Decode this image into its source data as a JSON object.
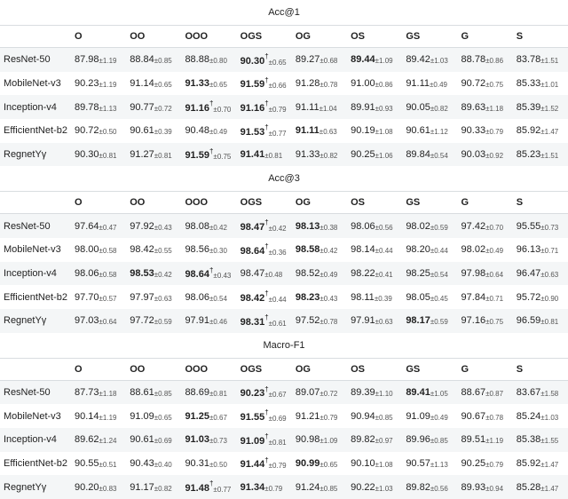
{
  "columns": [
    "O",
    "OO",
    "OOO",
    "OGS",
    "OG",
    "OS",
    "GS",
    "G",
    "S"
  ],
  "models": [
    "ResNet-50",
    "MobileNet-v3",
    "Inception-v4",
    "EfficientNet-b2",
    "RegnetYγ"
  ],
  "model_display": [
    "ResNet-50",
    "MobileNet-v3",
    "Inception-v4",
    "EfficientNet-b2",
    "RegnetYγ"
  ],
  "sections": [
    {
      "title": "Acc@1",
      "rows": [
        [
          {
            "v": "87.98",
            "s": "±1.19"
          },
          {
            "v": "88.84",
            "s": "±0.85"
          },
          {
            "v": "88.88",
            "s": "±0.80"
          },
          {
            "v": "90.30",
            "s": "±0.65",
            "b": true,
            "d": true
          },
          {
            "v": "89.27",
            "s": "±0.68"
          },
          {
            "v": "89.44",
            "s": "±1.09",
            "b": true
          },
          {
            "v": "89.42",
            "s": "±1.03"
          },
          {
            "v": "88.78",
            "s": "±0.86"
          },
          {
            "v": "83.78",
            "s": "±1.51"
          }
        ],
        [
          {
            "v": "90.23",
            "s": "±1.19"
          },
          {
            "v": "91.14",
            "s": "±0.65"
          },
          {
            "v": "91.33",
            "s": "±0.65",
            "b": true
          },
          {
            "v": "91.59",
            "s": "±0.66",
            "b": true,
            "d": true
          },
          {
            "v": "91.28",
            "s": "±0.78"
          },
          {
            "v": "91.00",
            "s": "±0.86"
          },
          {
            "v": "91.11",
            "s": "±0.49"
          },
          {
            "v": "90.72",
            "s": "±0.75"
          },
          {
            "v": "85.33",
            "s": "±1.01"
          }
        ],
        [
          {
            "v": "89.78",
            "s": "±1.13"
          },
          {
            "v": "90.77",
            "s": "±0.72"
          },
          {
            "v": "91.16",
            "s": "±0.70",
            "b": true,
            "d": true
          },
          {
            "v": "91.16",
            "s": "±0.79",
            "b": true,
            "d": true
          },
          {
            "v": "91.11",
            "s": "±1.04"
          },
          {
            "v": "89.91",
            "s": "±0.93"
          },
          {
            "v": "90.05",
            "s": "±0.82"
          },
          {
            "v": "89.63",
            "s": "±1.18"
          },
          {
            "v": "85.39",
            "s": "±1.52"
          }
        ],
        [
          {
            "v": "90.72",
            "s": "±0.50"
          },
          {
            "v": "90.61",
            "s": "±0.39"
          },
          {
            "v": "90.48",
            "s": "±0.49"
          },
          {
            "v": "91.53",
            "s": "±0.77",
            "b": true,
            "d": true
          },
          {
            "v": "91.11",
            "s": "±0.63",
            "b": true
          },
          {
            "v": "90.19",
            "s": "±1.08"
          },
          {
            "v": "90.61",
            "s": "±1.12"
          },
          {
            "v": "90.33",
            "s": "±0.79"
          },
          {
            "v": "85.92",
            "s": "±1.47"
          }
        ],
        [
          {
            "v": "90.30",
            "s": "±0.81"
          },
          {
            "v": "91.27",
            "s": "±0.81"
          },
          {
            "v": "91.59",
            "s": "±0.75",
            "b": true,
            "d": true
          },
          {
            "v": "91.41",
            "s": "±0.81",
            "b": true
          },
          {
            "v": "91.33",
            "s": "±0.82"
          },
          {
            "v": "90.25",
            "s": "±1.06"
          },
          {
            "v": "89.84",
            "s": "±0.54"
          },
          {
            "v": "90.03",
            "s": "±0.92"
          },
          {
            "v": "85.23",
            "s": "±1.51"
          }
        ]
      ]
    },
    {
      "title": "Acc@3",
      "rows": [
        [
          {
            "v": "97.64",
            "s": "±0.47"
          },
          {
            "v": "97.92",
            "s": "±0.43"
          },
          {
            "v": "98.08",
            "s": "±0.42"
          },
          {
            "v": "98.47",
            "s": "±0.42",
            "b": true,
            "d": true
          },
          {
            "v": "98.13",
            "s": "±0.38",
            "b": true
          },
          {
            "v": "98.06",
            "s": "±0.56"
          },
          {
            "v": "98.02",
            "s": "±0.59"
          },
          {
            "v": "97.42",
            "s": "±0.70"
          },
          {
            "v": "95.55",
            "s": "±0.73"
          }
        ],
        [
          {
            "v": "98.00",
            "s": "±0.58"
          },
          {
            "v": "98.42",
            "s": "±0.55"
          },
          {
            "v": "98.56",
            "s": "±0.30"
          },
          {
            "v": "98.64",
            "s": "±0.36",
            "b": true,
            "d": true
          },
          {
            "v": "98.58",
            "s": "±0.42",
            "b": true
          },
          {
            "v": "98.14",
            "s": "±0.44"
          },
          {
            "v": "98.20",
            "s": "±0.44"
          },
          {
            "v": "98.02",
            "s": "±0.49"
          },
          {
            "v": "96.13",
            "s": "±0.71"
          }
        ],
        [
          {
            "v": "98.06",
            "s": "±0.58"
          },
          {
            "v": "98.53",
            "s": "±0.42",
            "b": true
          },
          {
            "v": "98.64",
            "s": "±0.43",
            "b": true,
            "d": true
          },
          {
            "v": "98.47",
            "s": "±0.48"
          },
          {
            "v": "98.52",
            "s": "±0.49"
          },
          {
            "v": "98.22",
            "s": "±0.41"
          },
          {
            "v": "98.25",
            "s": "±0.54"
          },
          {
            "v": "97.98",
            "s": "±0.64"
          },
          {
            "v": "96.47",
            "s": "±0.63"
          }
        ],
        [
          {
            "v": "97.70",
            "s": "±0.57"
          },
          {
            "v": "97.97",
            "s": "±0.63"
          },
          {
            "v": "98.06",
            "s": "±0.54"
          },
          {
            "v": "98.42",
            "s": "±0.44",
            "b": true,
            "d": true
          },
          {
            "v": "98.23",
            "s": "±0.43",
            "b": true
          },
          {
            "v": "98.11",
            "s": "±0.39"
          },
          {
            "v": "98.05",
            "s": "±0.45"
          },
          {
            "v": "97.84",
            "s": "±0.71"
          },
          {
            "v": "95.72",
            "s": "±0.90"
          }
        ],
        [
          {
            "v": "97.03",
            "s": "±0.64"
          },
          {
            "v": "97.72",
            "s": "±0.59"
          },
          {
            "v": "97.91",
            "s": "±0.46"
          },
          {
            "v": "98.31",
            "s": "±0.61",
            "b": true,
            "d": true
          },
          {
            "v": "97.52",
            "s": "±0.78"
          },
          {
            "v": "97.91",
            "s": "±0.63"
          },
          {
            "v": "98.17",
            "s": "±0.59",
            "b": true
          },
          {
            "v": "97.16",
            "s": "±0.75"
          },
          {
            "v": "96.59",
            "s": "±0.81"
          }
        ]
      ]
    },
    {
      "title": "Macro-F1",
      "rows": [
        [
          {
            "v": "87.73",
            "s": "±1.18"
          },
          {
            "v": "88.61",
            "s": "±0.85"
          },
          {
            "v": "88.69",
            "s": "±0.81"
          },
          {
            "v": "90.23",
            "s": "±0.67",
            "b": true,
            "d": true
          },
          {
            "v": "89.07",
            "s": "±0.72"
          },
          {
            "v": "89.39",
            "s": "±1.10"
          },
          {
            "v": "89.41",
            "s": "±1.05",
            "b": true
          },
          {
            "v": "88.67",
            "s": "±0.87"
          },
          {
            "v": "83.67",
            "s": "±1.58"
          }
        ],
        [
          {
            "v": "90.14",
            "s": "±1.19"
          },
          {
            "v": "91.09",
            "s": "±0.65"
          },
          {
            "v": "91.25",
            "s": "±0.67",
            "b": true
          },
          {
            "v": "91.55",
            "s": "±0.69",
            "b": true,
            "d": true
          },
          {
            "v": "91.21",
            "s": "±0.79"
          },
          {
            "v": "90.94",
            "s": "±0.85"
          },
          {
            "v": "91.09",
            "s": "±0.49"
          },
          {
            "v": "90.67",
            "s": "±0.78"
          },
          {
            "v": "85.24",
            "s": "±1.03"
          }
        ],
        [
          {
            "v": "89.62",
            "s": "±1.24"
          },
          {
            "v": "90.61",
            "s": "±0.69"
          },
          {
            "v": "91.03",
            "s": "±0.73",
            "b": true
          },
          {
            "v": "91.09",
            "s": "±0.81",
            "b": true,
            "d": true
          },
          {
            "v": "90.98",
            "s": "±1.09"
          },
          {
            "v": "89.82",
            "s": "±0.97"
          },
          {
            "v": "89.96",
            "s": "±0.85"
          },
          {
            "v": "89.51",
            "s": "±1.19"
          },
          {
            "v": "85.38",
            "s": "±1.55"
          }
        ],
        [
          {
            "v": "90.55",
            "s": "±0.51"
          },
          {
            "v": "90.43",
            "s": "±0.40"
          },
          {
            "v": "90.31",
            "s": "±0.50"
          },
          {
            "v": "91.44",
            "s": "±0.79",
            "b": true,
            "d": true
          },
          {
            "v": "90.99",
            "s": "±0.65",
            "b": true
          },
          {
            "v": "90.10",
            "s": "±1.08"
          },
          {
            "v": "90.57",
            "s": "±1.13"
          },
          {
            "v": "90.25",
            "s": "±0.79"
          },
          {
            "v": "85.92",
            "s": "±1.47"
          }
        ],
        [
          {
            "v": "90.20",
            "s": "±0.83"
          },
          {
            "v": "91.17",
            "s": "±0.82"
          },
          {
            "v": "91.48",
            "s": "±0.77",
            "b": true,
            "d": true
          },
          {
            "v": "91.34",
            "s": "±0.79",
            "b": true
          },
          {
            "v": "91.24",
            "s": "±0.85"
          },
          {
            "v": "90.22",
            "s": "±1.03"
          },
          {
            "v": "89.82",
            "s": "±0.56"
          },
          {
            "v": "89.93",
            "s": "±0.94"
          },
          {
            "v": "85.28",
            "s": "±1.47"
          }
        ]
      ]
    }
  ],
  "chart_data": {
    "type": "table",
    "note": "Three metric blocks (Acc@1, Acc@3, Macro-F1); rows are backbone models, columns are augmentation/label-set configurations. Bold = best or near-best in row; † = statistically significant."
  }
}
